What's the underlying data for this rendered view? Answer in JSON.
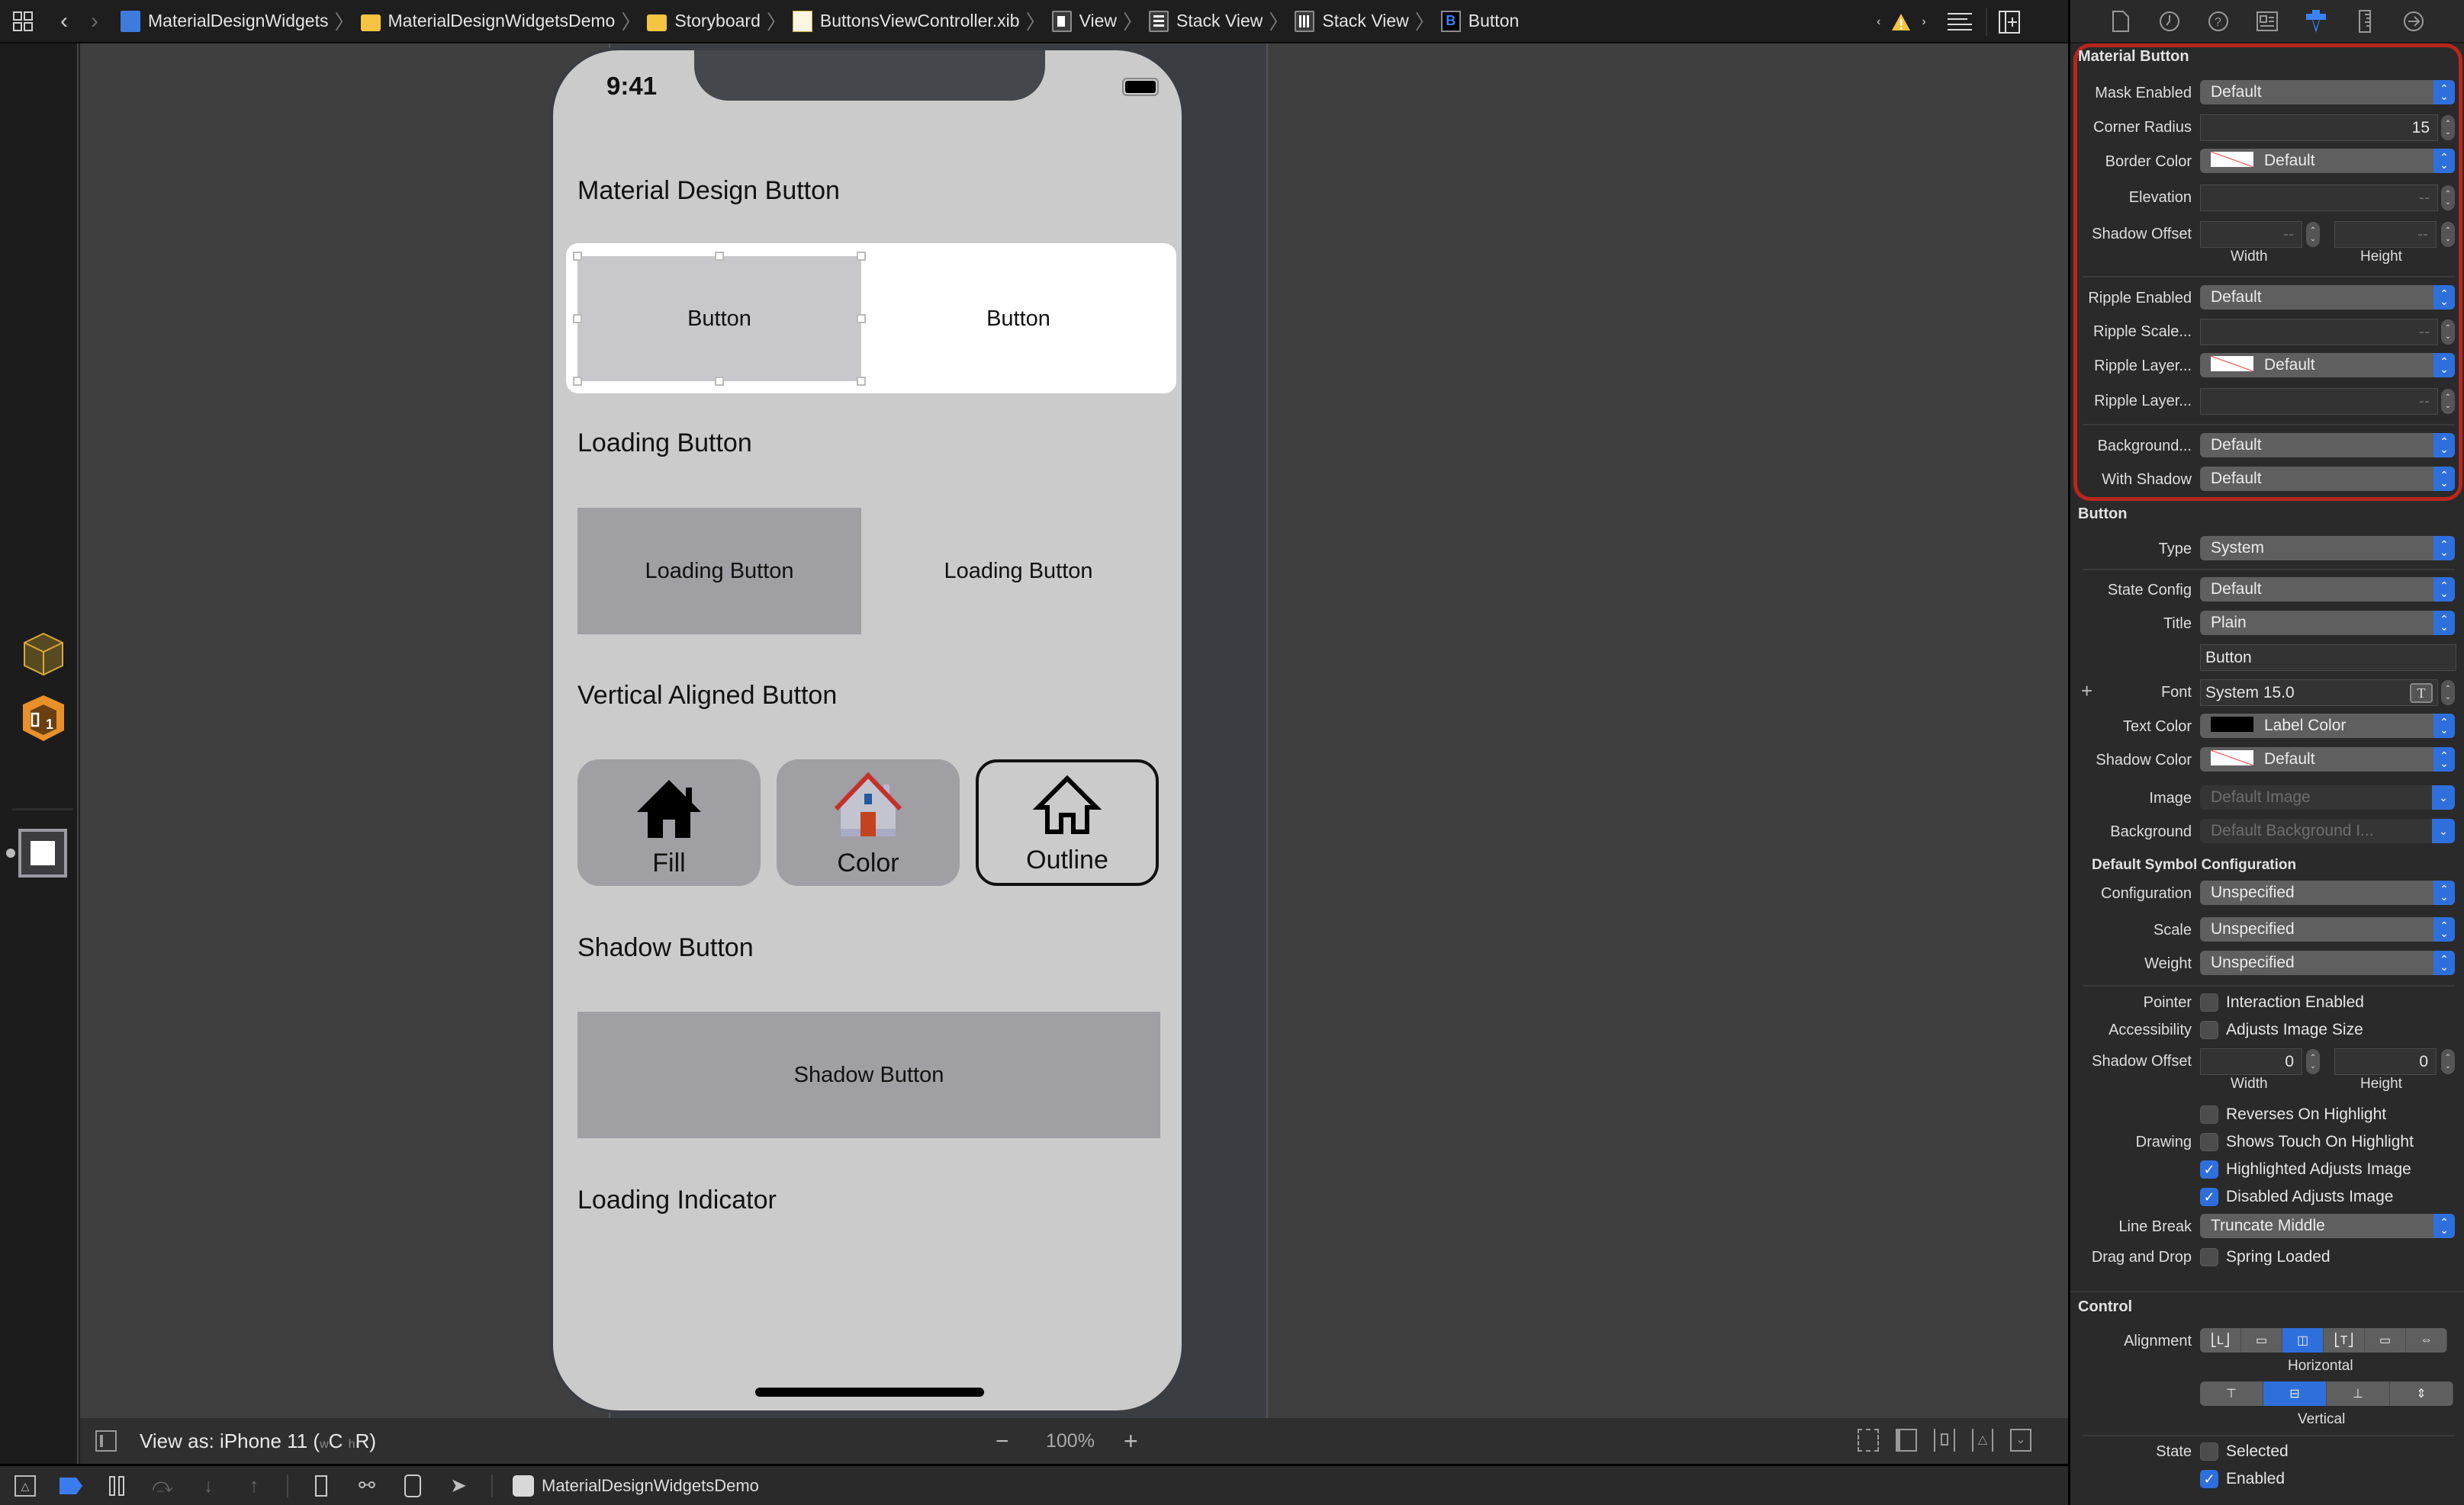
{
  "breadcrumb": [
    {
      "label": "MaterialDesignWidgets",
      "icon": "xcode-project-icon"
    },
    {
      "label": "MaterialDesignWidgetsDemo",
      "icon": "folder-icon"
    },
    {
      "label": "Storyboard",
      "icon": "folder-icon"
    },
    {
      "label": "ButtonsViewController.xib",
      "icon": "xib-file-icon"
    },
    {
      "label": "View",
      "icon": "view-icon"
    },
    {
      "label": "Stack View",
      "icon": "vertical-stack-icon"
    },
    {
      "label": "Stack View",
      "icon": "horizontal-stack-icon"
    },
    {
      "label": "Button",
      "icon": "button-icon"
    }
  ],
  "phone": {
    "time": "9:41",
    "sections": {
      "material": "Material Design Button",
      "loading": "Loading Button",
      "vertical": "Vertical Aligned Button",
      "shadow": "Shadow Button",
      "indicator": "Loading Indicator"
    },
    "material_buttons": [
      "Button",
      "Button"
    ],
    "loading_buttons": [
      "Loading Button",
      "Loading Button"
    ],
    "vertical_buttons": [
      "Fill",
      "Color",
      "Outline"
    ],
    "shadow_button": "Shadow Button"
  },
  "canvas": {
    "view_as": "View as: iPhone 11 (",
    "size_w": "w",
    "size_c": "C",
    "size_h": "h",
    "size_r": "R)",
    "zoom": "100%"
  },
  "statusbar": {
    "scheme": "MaterialDesignWidgetsDemo"
  },
  "inspector": {
    "material_button": {
      "title": "Material Button",
      "mask_enabled": {
        "label": "Mask Enabled",
        "value": "Default"
      },
      "corner_radius": {
        "label": "Corner Radius",
        "value": "15"
      },
      "border_color": {
        "label": "Border Color",
        "value": "Default"
      },
      "elevation": {
        "label": "Elevation",
        "value": "--"
      },
      "shadow_offset": {
        "label": "Shadow Offset",
        "width": "--",
        "height": "--",
        "width_label": "Width",
        "height_label": "Height"
      },
      "ripple_enabled": {
        "label": "Ripple Enabled",
        "value": "Default"
      },
      "ripple_scale": {
        "label": "Ripple Scale...",
        "value": "--"
      },
      "ripple_layer_color": {
        "label": "Ripple Layer...",
        "value": "Default"
      },
      "ripple_layer_alpha": {
        "label": "Ripple Layer...",
        "value": "--"
      },
      "background": {
        "label": "Background...",
        "value": "Default"
      },
      "with_shadow": {
        "label": "With Shadow",
        "value": "Default"
      }
    },
    "button": {
      "title": "Button",
      "type": {
        "label": "Type",
        "value": "System"
      },
      "state_config": {
        "label": "State Config",
        "value": "Default"
      },
      "title_style": {
        "label": "Title",
        "value": "Plain"
      },
      "title_text": "Button",
      "font": {
        "label": "Font",
        "value": "System 15.0"
      },
      "text_color": {
        "label": "Text Color",
        "value": "Label Color"
      },
      "shadow_color": {
        "label": "Shadow Color",
        "value": "Default"
      },
      "image": {
        "label": "Image",
        "placeholder": "Default Image"
      },
      "background": {
        "label": "Background",
        "placeholder": "Default Background I..."
      },
      "symbol_config_title": "Default Symbol Configuration",
      "configuration": {
        "label": "Configuration",
        "value": "Unspecified"
      },
      "scale": {
        "label": "Scale",
        "value": "Unspecified"
      },
      "weight": {
        "label": "Weight",
        "value": "Unspecified"
      },
      "pointer": {
        "label": "Pointer",
        "option": "Interaction Enabled",
        "checked": false
      },
      "accessibility": {
        "label": "Accessibility",
        "option": "Adjusts Image Size",
        "checked": false
      },
      "shadow_offset": {
        "label": "Shadow Offset",
        "width": "0",
        "height": "0",
        "width_label": "Width",
        "height_label": "Height"
      },
      "drawing": {
        "label": "Drawing",
        "options": [
          {
            "label": "Reverses On Highlight",
            "checked": false
          },
          {
            "label": "Shows Touch On Highlight",
            "checked": false
          },
          {
            "label": "Highlighted Adjusts Image",
            "checked": true
          },
          {
            "label": "Disabled Adjusts Image",
            "checked": true
          }
        ]
      },
      "line_break": {
        "label": "Line Break",
        "value": "Truncate Middle"
      },
      "drag_drop": {
        "label": "Drag and Drop",
        "option": "Spring Loaded",
        "checked": false
      }
    },
    "control": {
      "title": "Control",
      "alignment_label": "Alignment",
      "horizontal_label": "Horizontal",
      "vertical_label": "Vertical",
      "horizontal_selected": 2,
      "vertical_selected": 1,
      "state_label": "State",
      "state_options": [
        {
          "label": "Selected",
          "checked": false
        },
        {
          "label": "Enabled",
          "checked": true
        }
      ]
    }
  },
  "colors": {
    "accent": "#2f6fdc",
    "highlight_border": "#b9261c",
    "warning": "#f5c542"
  }
}
